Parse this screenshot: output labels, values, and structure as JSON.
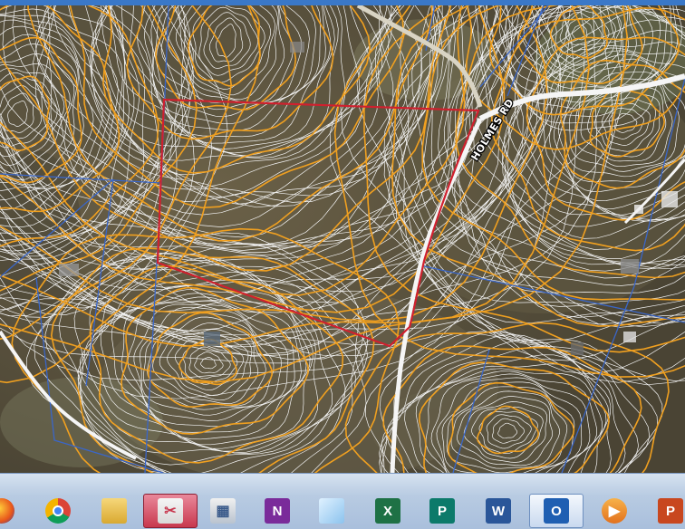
{
  "window": {
    "accent_color": "#3a78c8"
  },
  "map": {
    "road_label": "HOLMES RD",
    "colors": {
      "parcel_boundary": "#d0202e",
      "index_contour": "#f0a020",
      "intermediate_contour": "#f4f4f4",
      "property_line": "#3a66c8",
      "road": "#f5f5f5",
      "dirt_road": "#d9d4c4"
    }
  },
  "taskbar": {
    "items": [
      {
        "icon": "firefox-icon",
        "state": "normal"
      },
      {
        "icon": "chrome-icon",
        "state": "normal"
      },
      {
        "icon": "file-explorer-icon",
        "state": "normal"
      },
      {
        "icon": "snipping-tool-icon",
        "state": "pressed"
      },
      {
        "icon": "calculator-icon",
        "state": "normal"
      },
      {
        "icon": "onenote-icon",
        "letter": "N",
        "state": "normal"
      },
      {
        "icon": "notepad-icon",
        "state": "normal"
      },
      {
        "icon": "excel-icon",
        "letter": "X",
        "state": "normal"
      },
      {
        "icon": "publisher-icon",
        "letter": "P",
        "state": "normal"
      },
      {
        "icon": "word-icon",
        "letter": "W",
        "state": "normal"
      },
      {
        "icon": "outlook-icon",
        "letter": "O",
        "state": "active"
      },
      {
        "icon": "media-player-icon",
        "state": "normal"
      },
      {
        "icon": "powerpoint-icon",
        "letter": "P",
        "state": "normal"
      }
    ]
  }
}
